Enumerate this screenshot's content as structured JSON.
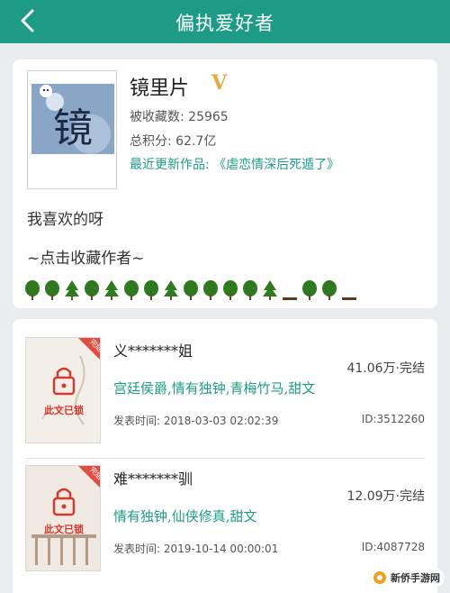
{
  "header": {
    "title": "偏执爱好者",
    "back_icon": "chevron-left-icon"
  },
  "author": {
    "name": "镜里片",
    "verified_badge": "V",
    "favorites_label": "被收藏数:",
    "favorites_value": "25965",
    "score_label": "总积分:",
    "score_value": "62.7亿",
    "latest_label": "最近更新作品:",
    "latest_value": "《虐恋情深后死遁了》",
    "avatar_glyph": "镜",
    "bio": "我喜欢的呀",
    "follow_text": "~点击收藏作者~",
    "decoration_icons": [
      "tree",
      "tree",
      "pine",
      "tree",
      "pine",
      "tree",
      "tree",
      "pine",
      "tree",
      "tree",
      "tree",
      "tree",
      "pine",
      "dash",
      "tree",
      "tree",
      "dash"
    ],
    "colors": {
      "accent": "#1e9b86",
      "badge": "#e5a93d",
      "tree": "#2f7a1f"
    }
  },
  "books": [
    {
      "title": "义*******姐",
      "wordcount": "41.06万",
      "status": "完结",
      "tags": "宫廷侯爵,情有独钟,青梅竹马,甜文",
      "date_label": "发表时间:",
      "date": "2018-03-03 02:02:39",
      "id_label": "ID:",
      "id": "3512260",
      "ribbon": "完结",
      "locked_text": "此文已锁"
    },
    {
      "title": "难*******驯",
      "wordcount": "12.09万",
      "status": "完结",
      "tags": "情有独钟,仙侠修真,甜文",
      "date_label": "发表时间:",
      "date": "2019-10-14 00:00:01",
      "id_label": "ID:",
      "id": "4087728",
      "ribbon": "完结",
      "locked_text": "此文已锁"
    }
  ],
  "watermark": {
    "text": "新侨手游网"
  }
}
